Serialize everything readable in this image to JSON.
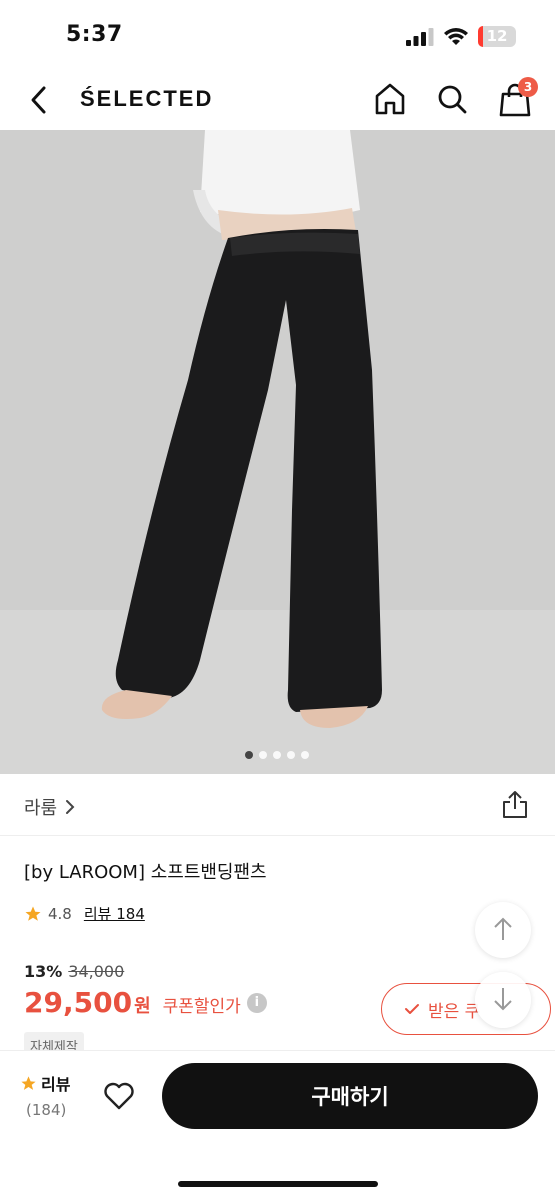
{
  "status": {
    "time": "5:37",
    "battery_level": "12",
    "battery_percent": 12
  },
  "header": {
    "brand": "ŚELECTED",
    "cart_count": "3"
  },
  "gallery": {
    "page_count": 5,
    "current_page": 1
  },
  "store": {
    "name": "라룸",
    "chevron": "›"
  },
  "product": {
    "name": "[by LAROOM] 소프트밴딩팬츠",
    "rating": "4.8",
    "review_link": "리뷰 184",
    "discount_rate": "13%",
    "original_price": "34,000",
    "price": "29,500",
    "price_unit": "원",
    "coupon_label": "쿠폰할인가",
    "coupon_button": "받은 쿠",
    "tag": "자체제작"
  },
  "bottom": {
    "review_label": "리뷰",
    "review_count": "(184)",
    "buy_label": "구매하기"
  },
  "colors": {
    "accent": "#e8513f",
    "star": "#f5a623",
    "dark": "#111111"
  },
  "icons": [
    "back-icon",
    "home-icon",
    "search-icon",
    "shopping-bag-icon",
    "share-icon",
    "star-icon",
    "info-icon",
    "check-icon",
    "arrow-up-icon",
    "arrow-down-icon",
    "heart-icon"
  ]
}
